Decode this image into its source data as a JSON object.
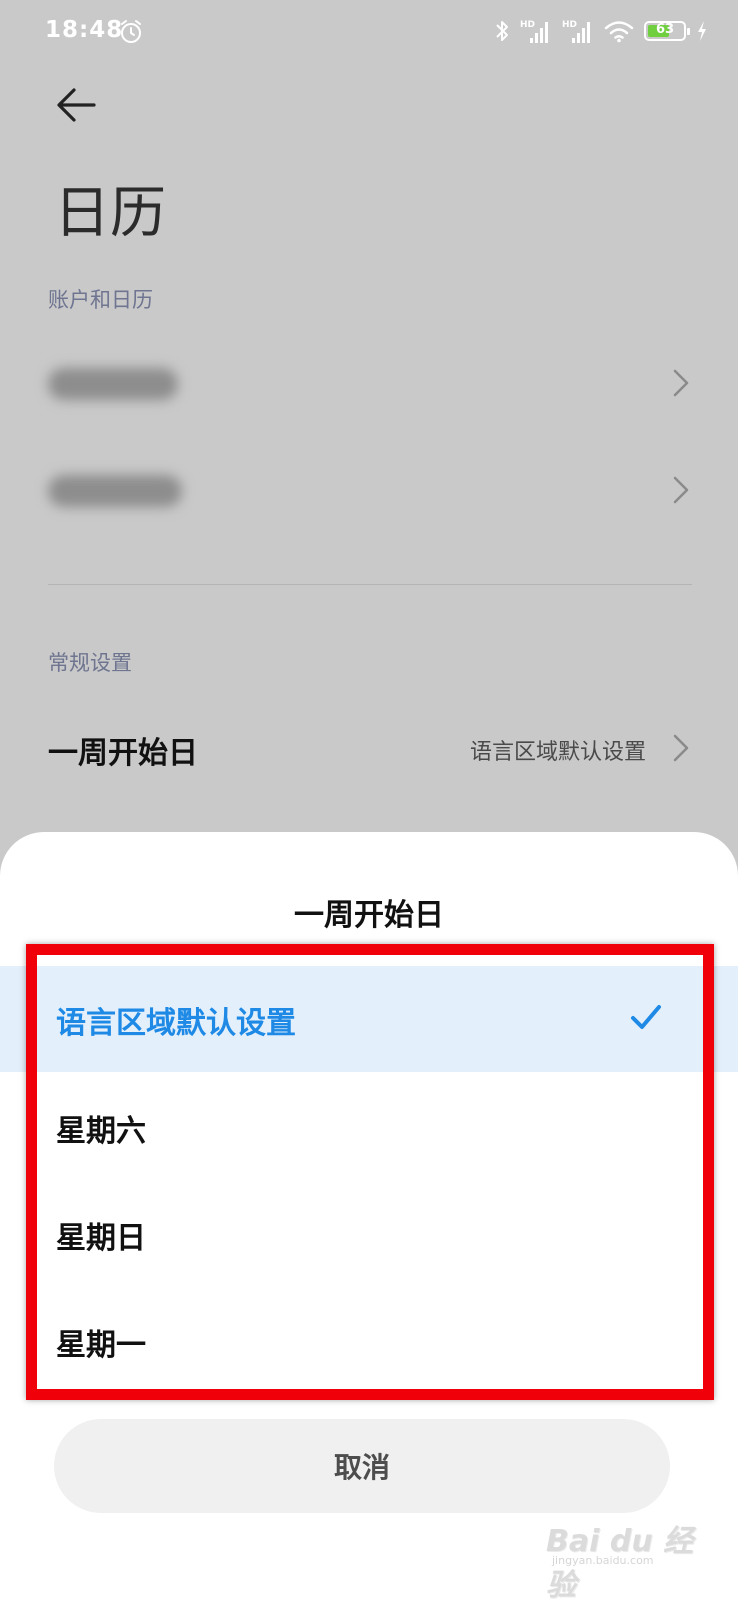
{
  "status_bar": {
    "time": "18:48",
    "battery_level": "63",
    "battery_fraction": 0.63,
    "icons": [
      "alarm-icon",
      "bluetooth-icon",
      "signal-hd-icon",
      "signal-hd-icon",
      "wifi-icon",
      "battery-icon",
      "charging-icon"
    ],
    "hd_label": "HD"
  },
  "header": {
    "title": "日历"
  },
  "accounts_section": {
    "label": "账户和日历"
  },
  "general_section": {
    "label": "常规设置",
    "week_start_title": "一周开始日",
    "week_start_value": "语言区域默认设置"
  },
  "dialog": {
    "title": "一周开始日",
    "options": [
      {
        "label": "语言区域默认设置",
        "selected": true
      },
      {
        "label": "星期六",
        "selected": false
      },
      {
        "label": "星期日",
        "selected": false
      },
      {
        "label": "星期一",
        "selected": false
      }
    ],
    "cancel_label": "取消"
  },
  "watermark": {
    "text": "Bai du 经验",
    "sub": "jingyan.baidu.com"
  },
  "colors": {
    "accent": "#1e8ae6",
    "selected_bg": "#e3effb",
    "highlight_frame": "#f00008",
    "scrim": "#c9c9c9"
  }
}
